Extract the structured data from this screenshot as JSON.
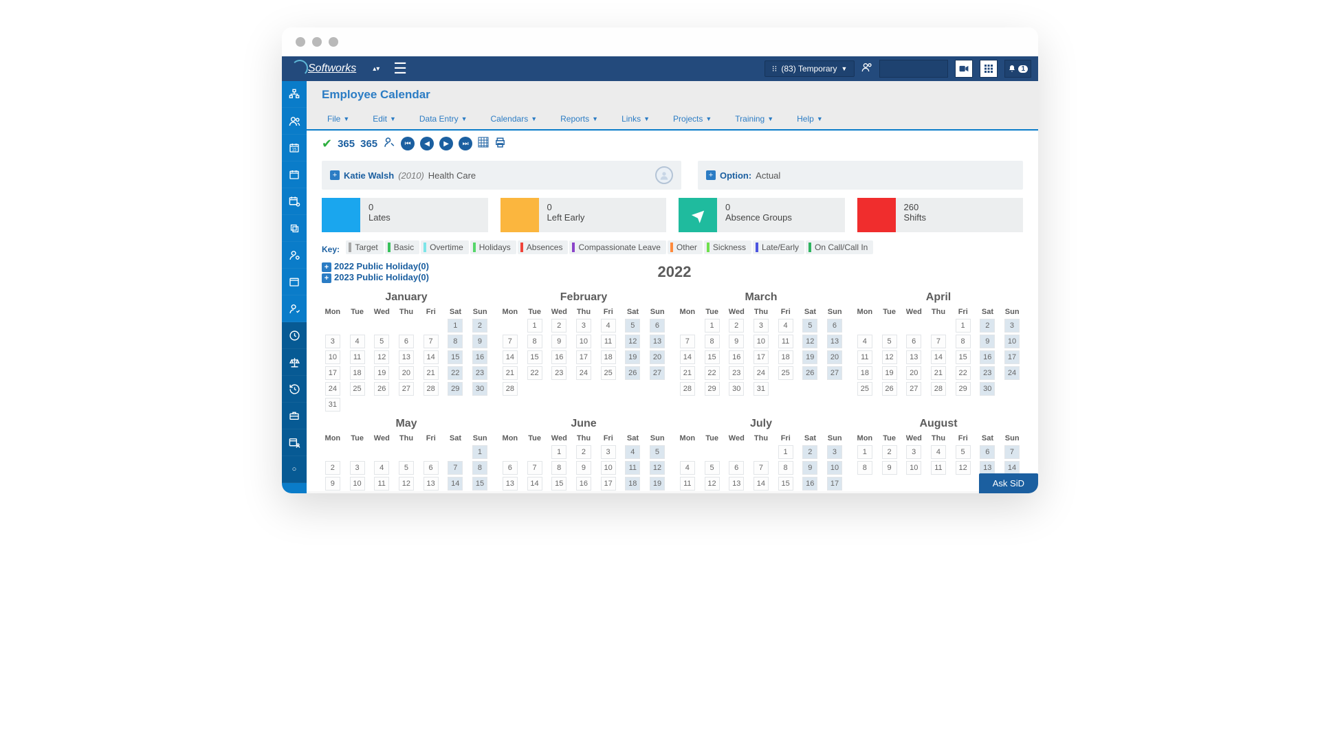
{
  "brand": "Softworks",
  "header": {
    "team_label": "(83) Temporary",
    "notif_count": "1"
  },
  "page_title": "Employee Calendar",
  "menus": [
    "File",
    "Edit",
    "Data Entry",
    "Calendars",
    "Reports",
    "Links",
    "Projects",
    "Training",
    "Help"
  ],
  "toolbar": {
    "t365a": "365",
    "t365b": "365"
  },
  "employee": {
    "name": "Katie Walsh",
    "id": "(2010)",
    "dept": "Health Care"
  },
  "option": {
    "label": "Option:",
    "value": "Actual"
  },
  "stats": {
    "lates": {
      "value": "0",
      "label": "Lates"
    },
    "left": {
      "value": "0",
      "label": "Left Early"
    },
    "absence": {
      "value": "0",
      "label": "Absence Groups"
    },
    "shifts": {
      "value": "260",
      "label": "Shifts"
    }
  },
  "key_label": "Key:",
  "legend": [
    {
      "label": "Target",
      "color": "#a8a8a8"
    },
    {
      "label": "Basic",
      "color": "#38c15b"
    },
    {
      "label": "Overtime",
      "color": "#7de5e8"
    },
    {
      "label": "Holidays",
      "color": "#56d66a"
    },
    {
      "label": "Absences",
      "color": "#f0433a"
    },
    {
      "label": "Compassionate Leave",
      "color": "#8b44c9"
    },
    {
      "label": "Other",
      "color": "#ff8a3c"
    },
    {
      "label": "Sickness",
      "color": "#6fe04d"
    },
    {
      "label": "Late/Early",
      "color": "#4d55e0"
    },
    {
      "label": "On Call/Call In",
      "color": "#2fb35f"
    }
  ],
  "holidays": {
    "link1": "2022 Public Holiday(0)",
    "link2": "2023 Public Holiday(0)"
  },
  "year": "2022",
  "dow": [
    "Mon",
    "Tue",
    "Wed",
    "Thu",
    "Fri",
    "Sat",
    "Sun"
  ],
  "months_row1": [
    {
      "name": "January",
      "start": 5,
      "days": 31
    },
    {
      "name": "February",
      "start": 1,
      "days": 28
    },
    {
      "name": "March",
      "start": 1,
      "days": 31
    },
    {
      "name": "April",
      "start": 4,
      "days": 30
    }
  ],
  "months_row2": [
    {
      "name": "May",
      "start": 6,
      "days": 15,
      "overflow": true
    },
    {
      "name": "June",
      "start": 2,
      "days": 19,
      "overflow": true
    },
    {
      "name": "July",
      "start": 4,
      "days": 17,
      "overflow": true
    },
    {
      "name": "August",
      "start": 0,
      "days": 14,
      "overflow": true
    }
  ],
  "ask_sid": "Ask SiD"
}
